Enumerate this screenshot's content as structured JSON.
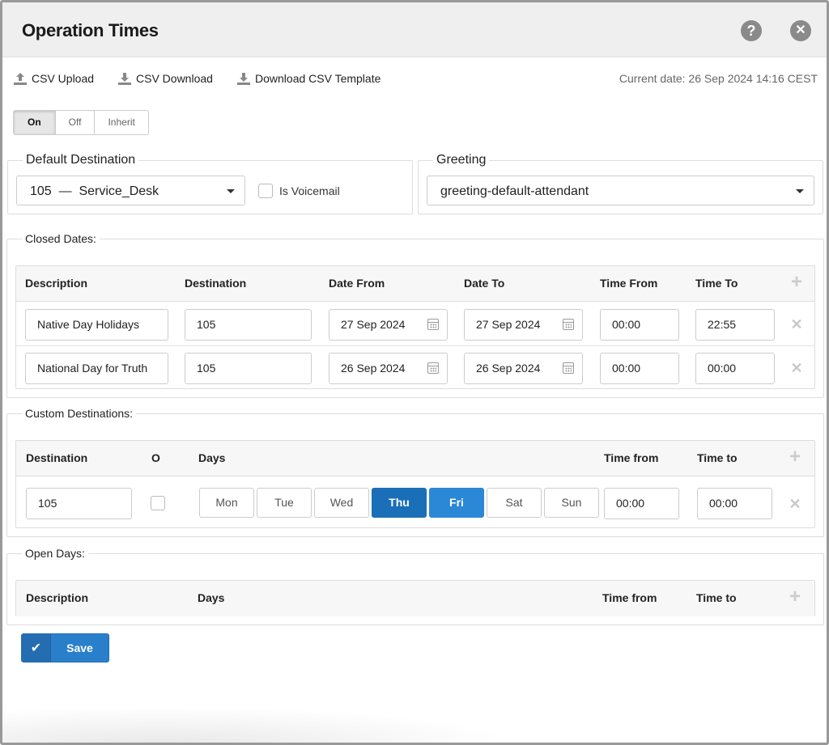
{
  "dialog": {
    "title": "Operation Times"
  },
  "header": {
    "help_icon": "question-circle-icon",
    "close_icon": "close-circle-icon"
  },
  "toolbar": {
    "csv_upload": "CSV Upload",
    "csv_download": "CSV Download",
    "download_template": "Download CSV Template",
    "current_date": "Current date: 26 Sep 2024 14:16 CEST"
  },
  "mode_toggle": {
    "options": [
      "On",
      "Off",
      "Inherit"
    ],
    "selected": "On"
  },
  "default_destination": {
    "legend": "Default Destination",
    "value": "105  —  Service_Desk",
    "voicemail_label": "Is Voicemail",
    "voicemail_checked": false
  },
  "greeting": {
    "legend": "Greeting",
    "value": "greeting-default-attendant"
  },
  "closed_dates": {
    "legend": "Closed Dates:",
    "columns": [
      "Description",
      "Destination",
      "Date From",
      "Date To",
      "Time From",
      "Time To"
    ],
    "rows": [
      {
        "description": "Native Day Holidays",
        "destination": "105",
        "date_from": "27 Sep 2024",
        "date_to": "27 Sep 2024",
        "time_from": "00:00",
        "time_to": "22:55"
      },
      {
        "description": "National Day for Truth",
        "destination": "105",
        "date_from": "26 Sep 2024",
        "date_to": "26 Sep 2024",
        "time_from": "00:00",
        "time_to": "00:00"
      }
    ]
  },
  "custom_destinations": {
    "legend": "Custom Destinations:",
    "columns": [
      "Destination",
      "O",
      "Days",
      "Time from",
      "Time to"
    ],
    "rows": [
      {
        "destination": "105",
        "o_checked": false,
        "days": [
          "Mon",
          "Tue",
          "Wed",
          "Thu",
          "Fri",
          "Sat",
          "Sun"
        ],
        "selected_days": [
          "Thu",
          "Fri"
        ],
        "time_from": "00:00",
        "time_to": "00:00"
      }
    ]
  },
  "open_days": {
    "legend": "Open Days:",
    "columns": [
      "Description",
      "Days",
      "Time from",
      "Time to"
    ]
  },
  "actions": {
    "save_label": "Save"
  },
  "colors": {
    "accent": "#2a7fcb",
    "selected_day_dark": "#1a6fb8",
    "selected_day": "#2a88d6"
  }
}
